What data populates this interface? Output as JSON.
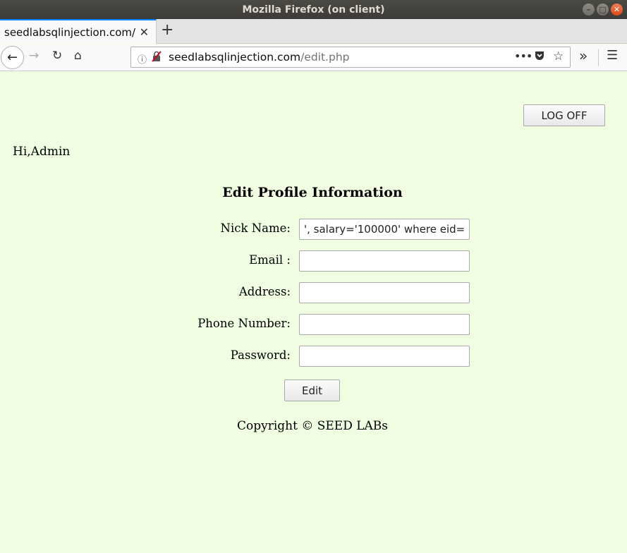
{
  "window": {
    "title": "Mozilla Firefox (on client)"
  },
  "tab": {
    "title": "seedlabsqlinjection.com/"
  },
  "url": {
    "host": "seedlabsqlinjection.com",
    "path": "/edit.php"
  },
  "page": {
    "logoff_label": "LOG OFF",
    "greeting": "Hi,Admin",
    "form_title": "Edit Profile Information",
    "fields": [
      {
        "label": "Nick Name:",
        "value": "', salary='100000' where eid="
      },
      {
        "label": "Email :",
        "value": ""
      },
      {
        "label": "Address:",
        "value": ""
      },
      {
        "label": "Phone Number:",
        "value": ""
      },
      {
        "label": "Password:",
        "value": ""
      }
    ],
    "edit_label": "Edit",
    "copyright": "Copyright © SEED LABs"
  },
  "colors": {
    "page_background": "#f0fde0",
    "tab_accent": "#0a84ff",
    "insecure_icon": "#d70022"
  }
}
